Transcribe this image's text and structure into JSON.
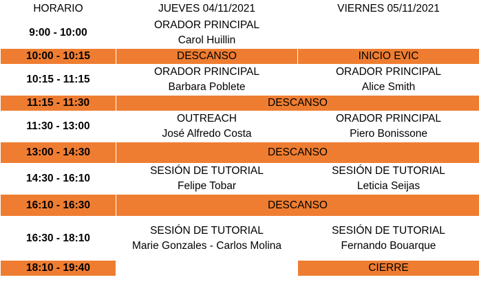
{
  "header": {
    "time": "HORARIO",
    "thursday": "JUEVES 04/11/2021",
    "friday": "VIERNES  05/11/2021"
  },
  "rows": [
    {
      "time": "9:00 - 10:00",
      "thu": [
        "ORADOR PRINCIPAL",
        "Carol Huillin"
      ],
      "fri": []
    },
    {
      "time": "10:00 - 10:15",
      "thu": [
        "DESCANSO"
      ],
      "fri": [
        "INICIO EVIC"
      ]
    },
    {
      "time": "10:15 - 11:15",
      "thu": [
        "ORADOR PRINCIPAL",
        "Barbara Poblete"
      ],
      "fri": [
        "ORADOR PRINCIPAL",
        "Alice Smith"
      ]
    },
    {
      "time": "11:15 - 11:30",
      "merged": "DESCANSO"
    },
    {
      "time": "11:30 - 13:00",
      "thu": [
        "OUTREACH",
        "José Alfredo Costa"
      ],
      "fri": [
        "ORADOR PRINCIPAL",
        "Piero Bonissone"
      ]
    },
    {
      "time": "13:00 - 14:30",
      "merged": "DESCANSO"
    },
    {
      "time": "14:30 - 16:10",
      "thu": [
        "SESIÓN DE TUTORIAL",
        "Felipe Tobar"
      ],
      "fri": [
        "SESIÓN DE TUTORIAL",
        "Leticia Seijas"
      ]
    },
    {
      "time": "16:10 - 16:30",
      "merged": "DESCANSO"
    },
    {
      "time": "16:30 - 18:10",
      "thu": [
        "SESIÓN DE TUTORIAL",
        "Marie Gonzales - Carlos Molina"
      ],
      "fri": [
        "SESIÓN DE TUTORIAL",
        "Fernando Bouarque"
      ]
    },
    {
      "time": "18:10 - 19:40",
      "thu": [],
      "fri": [
        "CIERRE"
      ]
    }
  ],
  "colors": {
    "accent": "#ef7d31",
    "background": "#ffffff",
    "text": "#000000"
  }
}
